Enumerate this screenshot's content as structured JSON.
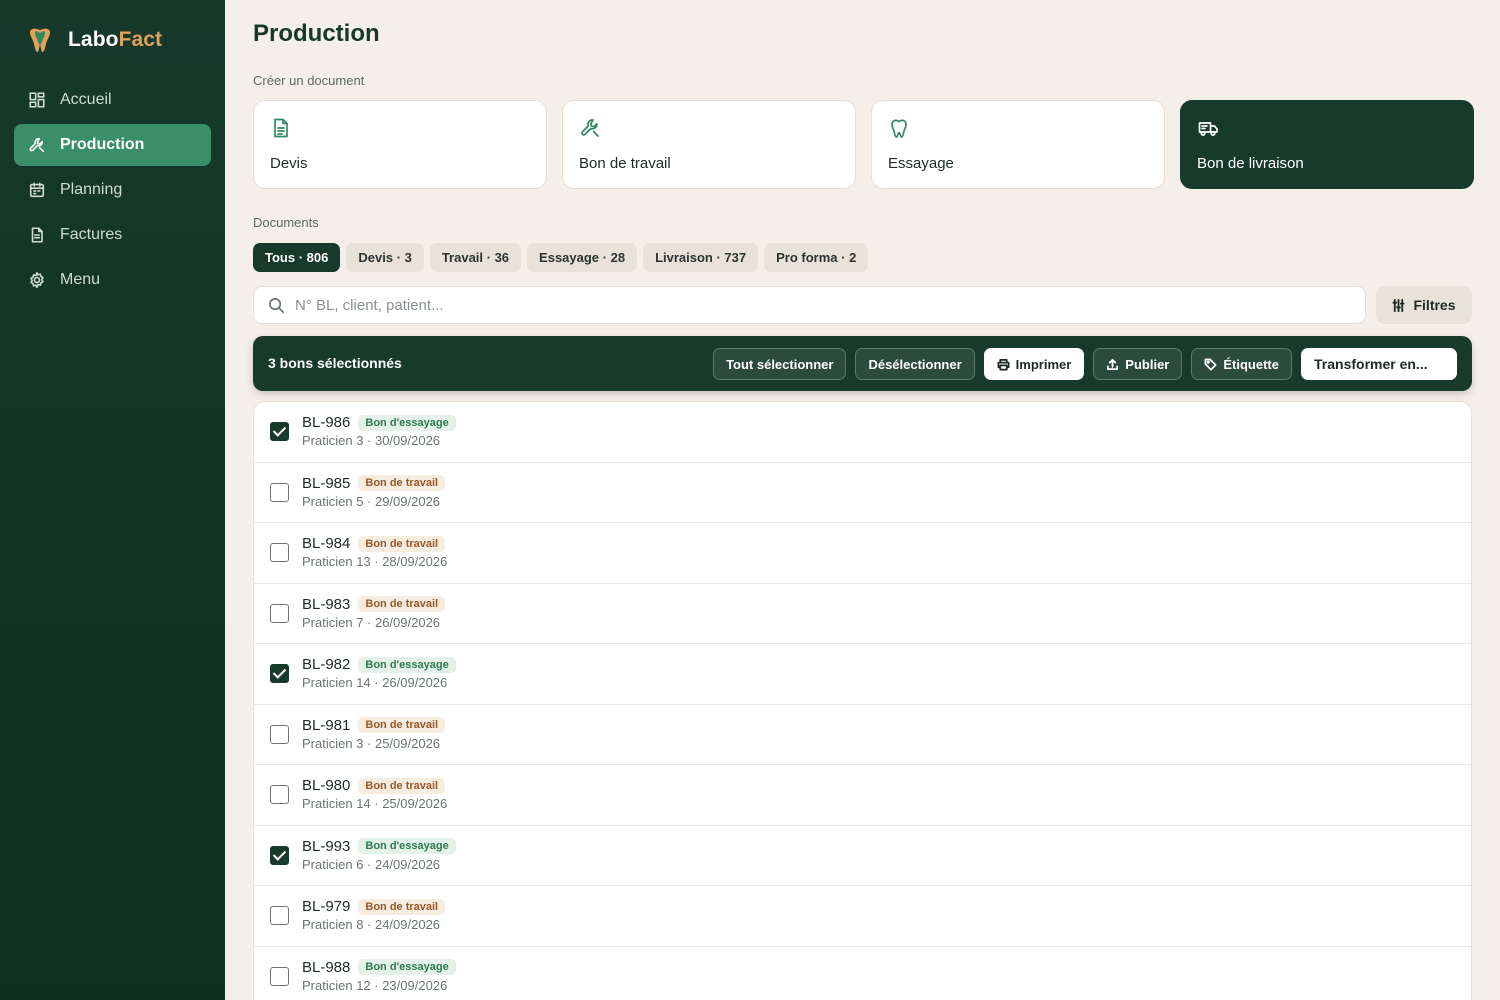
{
  "app": {
    "name_prefix": "Labo",
    "name_suffix": "Fact",
    "accent": "#e0a15a"
  },
  "sidebar": {
    "items": [
      {
        "label": "Accueil",
        "icon": "dashboard-icon",
        "active": false
      },
      {
        "label": "Production",
        "icon": "wrench-icon",
        "active": true
      },
      {
        "label": "Planning",
        "icon": "calendar-icon",
        "active": false
      },
      {
        "label": "Factures",
        "icon": "document-icon",
        "active": false
      },
      {
        "label": "Menu",
        "icon": "gear-icon",
        "active": false
      }
    ]
  },
  "page": {
    "title": "Production",
    "create_label": "Créer un document",
    "documents_label": "Documents"
  },
  "create_cards": [
    {
      "label": "Devis",
      "icon": "file-text-icon"
    },
    {
      "label": "Bon de travail",
      "icon": "wrench-icon"
    },
    {
      "label": "Essayage",
      "icon": "tooth-icon"
    },
    {
      "label": "Bon de livraison",
      "icon": "truck-icon"
    }
  ],
  "filters": [
    {
      "label": "Tous · 806",
      "active": true
    },
    {
      "label": "Devis · 3",
      "active": false
    },
    {
      "label": "Travail · 36",
      "active": false
    },
    {
      "label": "Essayage · 28",
      "active": false
    },
    {
      "label": "Livraison · 737",
      "active": false
    },
    {
      "label": "Pro forma · 2",
      "active": false
    }
  ],
  "search": {
    "placeholder": "N° BL, client, patient...",
    "value": "",
    "filters_label": "Filtres"
  },
  "selection_bar": {
    "count_label": "3 bons sélectionnés",
    "select_all": "Tout sélectionner",
    "deselect": "Désélectionner",
    "print": "Imprimer",
    "publish": "Publier",
    "label": "Étiquette",
    "transform": "Transformer en..."
  },
  "documents": [
    {
      "id": "BL-986",
      "type": "Bon d'essayage",
      "kind": "essai",
      "sub": "Praticien 3 · 30/09/2026",
      "checked": true
    },
    {
      "id": "BL-985",
      "type": "Bon de travail",
      "kind": "travail",
      "sub": "Praticien 5 · 29/09/2026",
      "checked": false
    },
    {
      "id": "BL-984",
      "type": "Bon de travail",
      "kind": "travail",
      "sub": "Praticien 13 · 28/09/2026",
      "checked": false
    },
    {
      "id": "BL-983",
      "type": "Bon de travail",
      "kind": "travail",
      "sub": "Praticien 7 · 26/09/2026",
      "checked": false
    },
    {
      "id": "BL-982",
      "type": "Bon d'essayage",
      "kind": "essai",
      "sub": "Praticien 14 · 26/09/2026",
      "checked": true
    },
    {
      "id": "BL-981",
      "type": "Bon de travail",
      "kind": "travail",
      "sub": "Praticien 3 · 25/09/2026",
      "checked": false
    },
    {
      "id": "BL-980",
      "type": "Bon de travail",
      "kind": "travail",
      "sub": "Praticien 14 · 25/09/2026",
      "checked": false
    },
    {
      "id": "BL-993",
      "type": "Bon d'essayage",
      "kind": "essai",
      "sub": "Praticien 6 · 24/09/2026",
      "checked": true
    },
    {
      "id": "BL-979",
      "type": "Bon de travail",
      "kind": "travail",
      "sub": "Praticien 8 · 24/09/2026",
      "checked": false
    },
    {
      "id": "BL-988",
      "type": "Bon d'essayage",
      "kind": "essai",
      "sub": "Praticien 12 · 23/09/2026",
      "checked": false
    }
  ]
}
